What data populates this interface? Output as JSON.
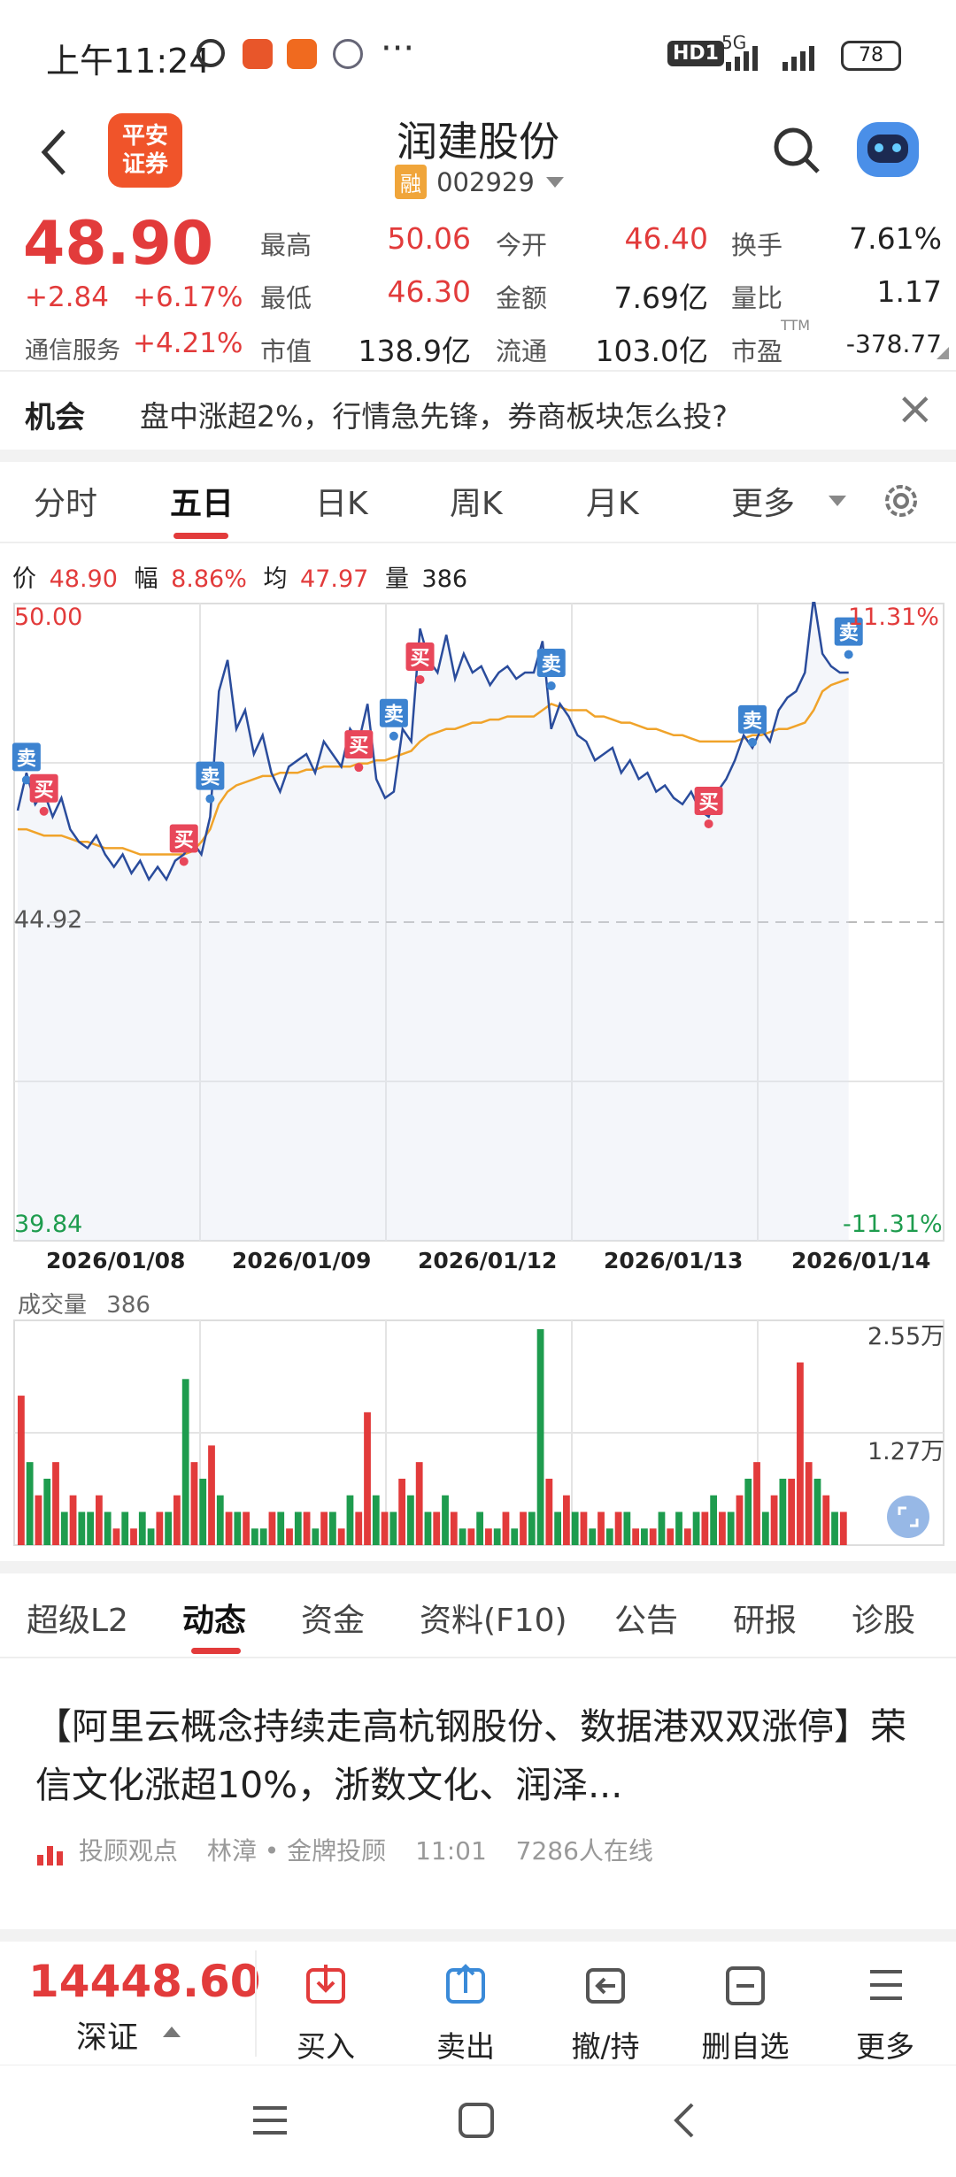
{
  "status": {
    "time": "上午11:24",
    "more": "···",
    "network": "HD1",
    "signal": "5G",
    "battery": "78"
  },
  "header": {
    "back_label": "‹",
    "title": "润建股份",
    "rong_badge": "融",
    "code": "002929",
    "logo_line1": "平安",
    "logo_line2": "证券"
  },
  "quote": {
    "price": "48.90",
    "change": "+2.84",
    "change_pct": "+6.17%",
    "sector_name": "通信服务",
    "sector_pct": "+4.21%",
    "high_label": "最高",
    "high": "50.06",
    "open_label": "今开",
    "open": "46.40",
    "turnover_label": "换手",
    "turnover": "7.61%",
    "low_label": "最低",
    "low": "46.30",
    "amount_label": "金额",
    "amount": "7.69亿",
    "volratio_label": "量比",
    "volratio": "1.17",
    "mcap_label": "市值",
    "mcap": "138.9亿",
    "float_label": "流通",
    "float": "103.0亿",
    "pe_label": "市盈",
    "pe_sup": "TTM",
    "pe": "-378.77"
  },
  "banner": {
    "tag": "机会",
    "text": "盘中涨超2%，行情急先锋，券商板块怎么投?",
    "close": "×"
  },
  "tabs": [
    "分时",
    "五日",
    "日K",
    "周K",
    "月K",
    "更多"
  ],
  "active_tab": "五日",
  "info": {
    "price_label": "价",
    "price": "48.90",
    "amp_label": "幅",
    "amp": "8.86%",
    "avg_label": "均",
    "avg": "47.97",
    "vol_label": "量",
    "vol": "386"
  },
  "chart_data": {
    "type": "line",
    "x": [
      "2026/01/08",
      "2026/01/09",
      "2026/01/12",
      "2026/01/13",
      "2026/01/14"
    ],
    "ylim": [
      39.84,
      50.0
    ],
    "y_top_label": "50.00",
    "y_mid_label": "44.92",
    "y_bottom_label": "39.84",
    "pct_top": "11.31%",
    "pct_bottom": "-11.31%",
    "series": [
      {
        "values": [
          46.7,
          47.3,
          46.8,
          47.0,
          46.6,
          46.9,
          46.4,
          46.2,
          46.1,
          46.3,
          46.0,
          45.8,
          46.0,
          45.7,
          45.9,
          45.6,
          45.8,
          45.6,
          45.9,
          46.0,
          46.2,
          46.0,
          46.6,
          48.6,
          49.1,
          48.0,
          48.3,
          47.6,
          47.9,
          47.3,
          47.0,
          47.4,
          47.5,
          47.6,
          47.3,
          47.8,
          47.6,
          47.4,
          48.0,
          47.8,
          48.4,
          47.2,
          46.9,
          47.0,
          48.0,
          47.8,
          49.6,
          49.1,
          48.9,
          49.5,
          48.8,
          49.2,
          48.9,
          49.0,
          48.7,
          48.9,
          49.0,
          48.8,
          48.9,
          48.9,
          49.4,
          48.0,
          48.4,
          48.2,
          47.9,
          47.8,
          47.5,
          47.6,
          47.7,
          47.3,
          47.5,
          47.2,
          47.3,
          47.0,
          47.1,
          46.9,
          46.8,
          47.0,
          46.7,
          46.6,
          47.0,
          47.2,
          47.5,
          47.9,
          47.7,
          48.0,
          47.8,
          48.3,
          48.5,
          48.6,
          48.9,
          50.1,
          49.2,
          49.0,
          48.9,
          48.9
        ]
      },
      {
        "values": [
          46.4,
          46.4,
          46.35,
          46.3,
          46.3,
          46.3,
          46.25,
          46.2,
          46.2,
          46.15,
          46.1,
          46.1,
          46.1,
          46.05,
          46.0,
          46.0,
          46.0,
          46.0,
          46.0,
          46.0,
          46.05,
          46.2,
          46.4,
          46.8,
          47.0,
          47.1,
          47.15,
          47.2,
          47.25,
          47.25,
          47.3,
          47.3,
          47.3,
          47.35,
          47.35,
          47.4,
          47.4,
          47.4,
          47.4,
          47.45,
          47.45,
          47.5,
          47.5,
          47.55,
          47.6,
          47.65,
          47.8,
          47.9,
          47.95,
          48.0,
          48.0,
          48.05,
          48.1,
          48.1,
          48.15,
          48.15,
          48.2,
          48.2,
          48.2,
          48.2,
          48.3,
          48.4,
          48.35,
          48.3,
          48.3,
          48.3,
          48.2,
          48.2,
          48.15,
          48.1,
          48.1,
          48.05,
          48.0,
          48.0,
          47.95,
          47.9,
          47.9,
          47.85,
          47.8,
          47.8,
          47.8,
          47.8,
          47.8,
          47.85,
          47.9,
          47.9,
          47.95,
          48.0,
          48.0,
          48.05,
          48.1,
          48.3,
          48.6,
          48.7,
          48.75,
          48.8
        ]
      }
    ],
    "trade_marks": [
      {
        "label": "卖",
        "kind": "sell",
        "x": 1,
        "y": 47.3
      },
      {
        "label": "买",
        "kind": "buy",
        "x": 3,
        "y": 46.8
      },
      {
        "label": "买",
        "kind": "buy",
        "x": 19,
        "y": 46.0
      },
      {
        "label": "卖",
        "kind": "sell",
        "x": 22,
        "y": 47.0
      },
      {
        "label": "买",
        "kind": "buy",
        "x": 39,
        "y": 47.5
      },
      {
        "label": "卖",
        "kind": "sell",
        "x": 43,
        "y": 48.0
      },
      {
        "label": "买",
        "kind": "buy",
        "x": 46,
        "y": 48.9
      },
      {
        "label": "卖",
        "kind": "sell",
        "x": 61,
        "y": 48.8
      },
      {
        "label": "买",
        "kind": "buy",
        "x": 79,
        "y": 46.6
      },
      {
        "label": "卖",
        "kind": "sell",
        "x": 84,
        "y": 47.9
      },
      {
        "label": "卖",
        "kind": "sell",
        "x": 95,
        "y": 49.3
      }
    ]
  },
  "volume": {
    "label": "成交量",
    "value": "386",
    "max_label": "2.55万",
    "mid_label": "1.27万",
    "bars": [
      9,
      5,
      3,
      4,
      5,
      2,
      3,
      2,
      2,
      3,
      2,
      1,
      2,
      1,
      2,
      1,
      2,
      2,
      3,
      10,
      5,
      4,
      6,
      3,
      2,
      2,
      2,
      1,
      1,
      2,
      2,
      1,
      2,
      2,
      1,
      2,
      2,
      1,
      3,
      2,
      8,
      3,
      2,
      2,
      4,
      3,
      5,
      2,
      2,
      3,
      2,
      1,
      1,
      2,
      1,
      1,
      2,
      1,
      2,
      2,
      13,
      4,
      2,
      3,
      2,
      2,
      1,
      2,
      1,
      2,
      2,
      1,
      1,
      1,
      2,
      1,
      2,
      1,
      2,
      2,
      3,
      2,
      2,
      3,
      4,
      5,
      2,
      3,
      4,
      4,
      11,
      5,
      4,
      3,
      2,
      2
    ],
    "colors": [
      "r",
      "g",
      "r",
      "g",
      "r",
      "g",
      "r",
      "g",
      "g",
      "r",
      "g",
      "r",
      "g",
      "r",
      "g",
      "g",
      "r",
      "g",
      "r",
      "g",
      "r",
      "g",
      "r",
      "g",
      "r",
      "g",
      "r",
      "g",
      "g",
      "r",
      "g",
      "r",
      "g",
      "r",
      "g",
      "r",
      "g",
      "r",
      "g",
      "r",
      "r",
      "g",
      "r",
      "g",
      "r",
      "g",
      "r",
      "g",
      "r",
      "g",
      "r",
      "g",
      "r",
      "g",
      "r",
      "g",
      "r",
      "g",
      "r",
      "g",
      "g",
      "r",
      "g",
      "r",
      "g",
      "r",
      "g",
      "r",
      "g",
      "r",
      "g",
      "r",
      "g",
      "r",
      "g",
      "r",
      "g",
      "r",
      "g",
      "r",
      "g",
      "r",
      "g",
      "r",
      "g",
      "r",
      "g",
      "r",
      "g",
      "r",
      "r",
      "r",
      "g",
      "r",
      "g",
      "r"
    ]
  },
  "news_tabs": [
    "超级L2",
    "动态",
    "资金",
    "资料(F10)",
    "公告",
    "研报",
    "诊股"
  ],
  "active_news_tab": "动态",
  "article": {
    "title": "【阿里云概念持续走高杭钢股份、数据港双双涨停】荣信文化涨超10%，浙数文化、润泽...",
    "source": "投顾观点",
    "author": "林漳 • 金牌投顾",
    "time": "11:01",
    "online": "7286人在线"
  },
  "bottom": {
    "index_value": "14448.60",
    "index_name": "深证",
    "buy": "买入",
    "sell": "卖出",
    "cancel": "撤/持",
    "remove": "删自选",
    "more": "更多"
  },
  "colors": {
    "up": "#e23b3b",
    "down": "#1e9c4e",
    "price_line": "#2a4c9c",
    "avg_line": "#f0a32a",
    "buy_mark": "#e8475a",
    "sell_mark": "#3d83d0"
  }
}
